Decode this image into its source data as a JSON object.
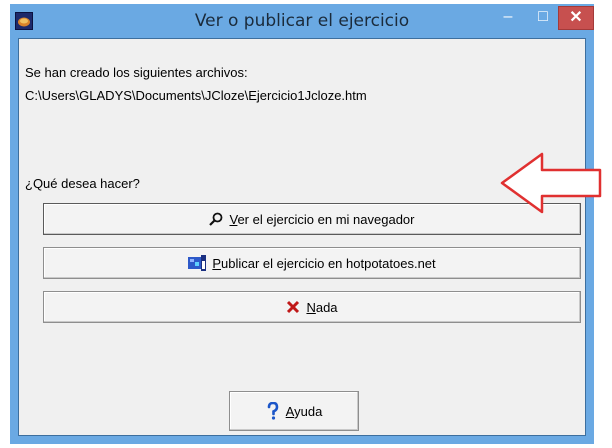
{
  "window": {
    "title": "Ver o publicar el ejercicio",
    "controls": {
      "minimize": "–",
      "maximize": "□",
      "close": "✕"
    }
  },
  "message": {
    "line1": "Se han creado los siguientes archivos:",
    "line2": "C:\\Users\\GLADYS\\Documents\\JCloze\\Ejercicio1Jcloze.htm"
  },
  "question": "¿Qué desea hacer?",
  "buttons": {
    "view": {
      "label": "Ver el ejercicio en mi navegador",
      "icon": "magnifier-icon"
    },
    "publish": {
      "label": "Publicar el ejercicio en hotpotatoes.net",
      "icon": "web-publish-icon"
    },
    "nothing": {
      "label": "Nada",
      "icon": "red-x-icon"
    },
    "help": {
      "label": "Ayuda",
      "icon": "question-mark-icon"
    }
  },
  "colors": {
    "titlebar": "#6aa9e3",
    "close_button": "#c7504f",
    "annotation_arrow": "#e03030"
  }
}
